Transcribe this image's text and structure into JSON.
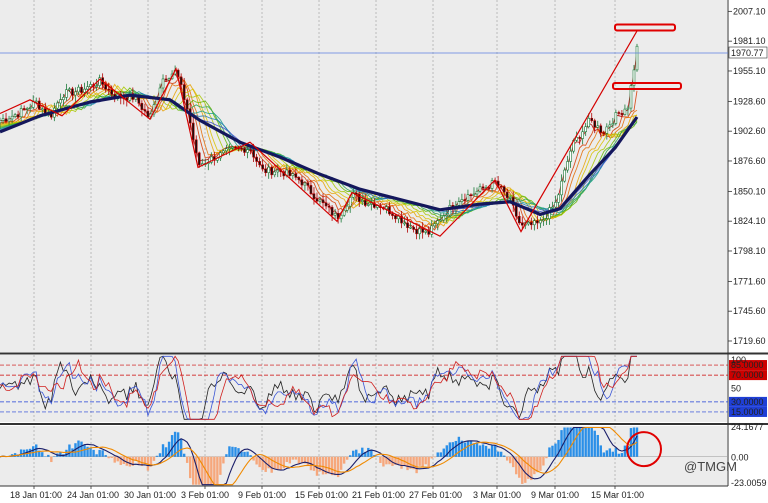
{
  "chart_data": [
    {
      "panel": "price",
      "type": "candlestick",
      "x_dates": [
        "18 Jan 01:00",
        "24 Jan 01:00",
        "30 Jan 01:00",
        "3 Feb 01:00",
        "9 Feb 01:00",
        "15 Feb 01:00",
        "21 Feb 01:00",
        "27 Feb 01:00",
        "3 Mar 01:00",
        "9 Mar 01:00",
        "15 Mar 01:00"
      ],
      "y_ticks": [
        "2007.10",
        "1981.10",
        "1955.10",
        "1928.60",
        "1902.60",
        "1876.60",
        "1850.10",
        "1824.10",
        "1798.10",
        "1771.60",
        "1745.60",
        "1719.60"
      ],
      "ylim": [
        1710,
        2017
      ],
      "current_price": "1970.77",
      "close_path": [
        {
          "x": 0,
          "y": 1912
        },
        {
          "x": 18,
          "y": 1918
        },
        {
          "x": 36,
          "y": 1928
        },
        {
          "x": 50,
          "y": 1915
        },
        {
          "x": 62,
          "y": 1935
        },
        {
          "x": 80,
          "y": 1938
        },
        {
          "x": 100,
          "y": 1946
        },
        {
          "x": 115,
          "y": 1933
        },
        {
          "x": 135,
          "y": 1932
        },
        {
          "x": 150,
          "y": 1913
        },
        {
          "x": 162,
          "y": 1948
        },
        {
          "x": 176,
          "y": 1955
        },
        {
          "x": 188,
          "y": 1920
        },
        {
          "x": 198,
          "y": 1873
        },
        {
          "x": 215,
          "y": 1880
        },
        {
          "x": 232,
          "y": 1886
        },
        {
          "x": 250,
          "y": 1888
        },
        {
          "x": 262,
          "y": 1868
        },
        {
          "x": 280,
          "y": 1868
        },
        {
          "x": 300,
          "y": 1860
        },
        {
          "x": 318,
          "y": 1843
        },
        {
          "x": 337,
          "y": 1827
        },
        {
          "x": 352,
          "y": 1847
        },
        {
          "x": 365,
          "y": 1841
        },
        {
          "x": 380,
          "y": 1838
        },
        {
          "x": 395,
          "y": 1830
        },
        {
          "x": 412,
          "y": 1818
        },
        {
          "x": 428,
          "y": 1813
        },
        {
          "x": 440,
          "y": 1826
        },
        {
          "x": 458,
          "y": 1843
        },
        {
          "x": 475,
          "y": 1849
        },
        {
          "x": 495,
          "y": 1858
        },
        {
          "x": 510,
          "y": 1842
        },
        {
          "x": 521,
          "y": 1819
        },
        {
          "x": 540,
          "y": 1822
        },
        {
          "x": 556,
          "y": 1840
        },
        {
          "x": 572,
          "y": 1890
        },
        {
          "x": 590,
          "y": 1912
        },
        {
          "x": 603,
          "y": 1902
        },
        {
          "x": 615,
          "y": 1915
        },
        {
          "x": 628,
          "y": 1925
        },
        {
          "x": 634,
          "y": 1958
        },
        {
          "x": 637,
          "y": 1975
        }
      ],
      "zigzag": [
        {
          "x": 0,
          "y": 1918
        },
        {
          "x": 30,
          "y": 1930
        },
        {
          "x": 62,
          "y": 1916
        },
        {
          "x": 100,
          "y": 1948
        },
        {
          "x": 150,
          "y": 1913
        },
        {
          "x": 176,
          "y": 1957
        },
        {
          "x": 198,
          "y": 1871
        },
        {
          "x": 250,
          "y": 1893
        },
        {
          "x": 337,
          "y": 1824
        },
        {
          "x": 352,
          "y": 1849
        },
        {
          "x": 440,
          "y": 1811
        },
        {
          "x": 495,
          "y": 1860
        },
        {
          "x": 521,
          "y": 1815
        },
        {
          "x": 637,
          "y": 1990
        }
      ],
      "slow_ma": [
        {
          "x": 0,
          "y": 1902
        },
        {
          "x": 40,
          "y": 1916
        },
        {
          "x": 90,
          "y": 1928
        },
        {
          "x": 130,
          "y": 1934
        },
        {
          "x": 170,
          "y": 1930
        },
        {
          "x": 200,
          "y": 1912
        },
        {
          "x": 240,
          "y": 1893
        },
        {
          "x": 280,
          "y": 1880
        },
        {
          "x": 320,
          "y": 1865
        },
        {
          "x": 360,
          "y": 1852
        },
        {
          "x": 400,
          "y": 1843
        },
        {
          "x": 440,
          "y": 1834
        },
        {
          "x": 480,
          "y": 1839
        },
        {
          "x": 510,
          "y": 1841
        },
        {
          "x": 540,
          "y": 1830
        },
        {
          "x": 560,
          "y": 1835
        },
        {
          "x": 590,
          "y": 1865
        },
        {
          "x": 615,
          "y": 1888
        },
        {
          "x": 637,
          "y": 1915
        }
      ],
      "annotations": [
        {
          "kind": "box",
          "x_from": 615,
          "x_to": 675,
          "y": 1993
        },
        {
          "kind": "box",
          "x_from": 613,
          "x_to": 681,
          "y": 1942
        }
      ]
    },
    {
      "panel": "oscillator",
      "type": "line",
      "ylim": [
        0,
        100
      ],
      "top_label": "100",
      "mid_label": "50",
      "levels": [
        {
          "label": "85.0000",
          "value": 85,
          "color": "#cc0000"
        },
        {
          "label": "70.0000",
          "value": 70,
          "color": "#cc0000"
        },
        {
          "label": "30.0000",
          "value": 30,
          "color": "#1f3fd6"
        },
        {
          "label": "15.0000",
          "value": 15,
          "color": "#1f3fd6"
        }
      ]
    },
    {
      "panel": "histogram",
      "type": "bar",
      "y_ticks": [
        "24.1677",
        "0.00",
        "-23.0059"
      ],
      "ylim": [
        -23.0059,
        24.1677
      ]
    }
  ],
  "watermark": "@TMGM",
  "colors": {
    "up": "#1d7a3a",
    "down": "#b00000",
    "zigzag": "#d40000",
    "slow_ma": "#14175c",
    "hist_pos": "#2a8fe8",
    "hist_neg": "#f6a77c",
    "osc_line": "#222222"
  }
}
